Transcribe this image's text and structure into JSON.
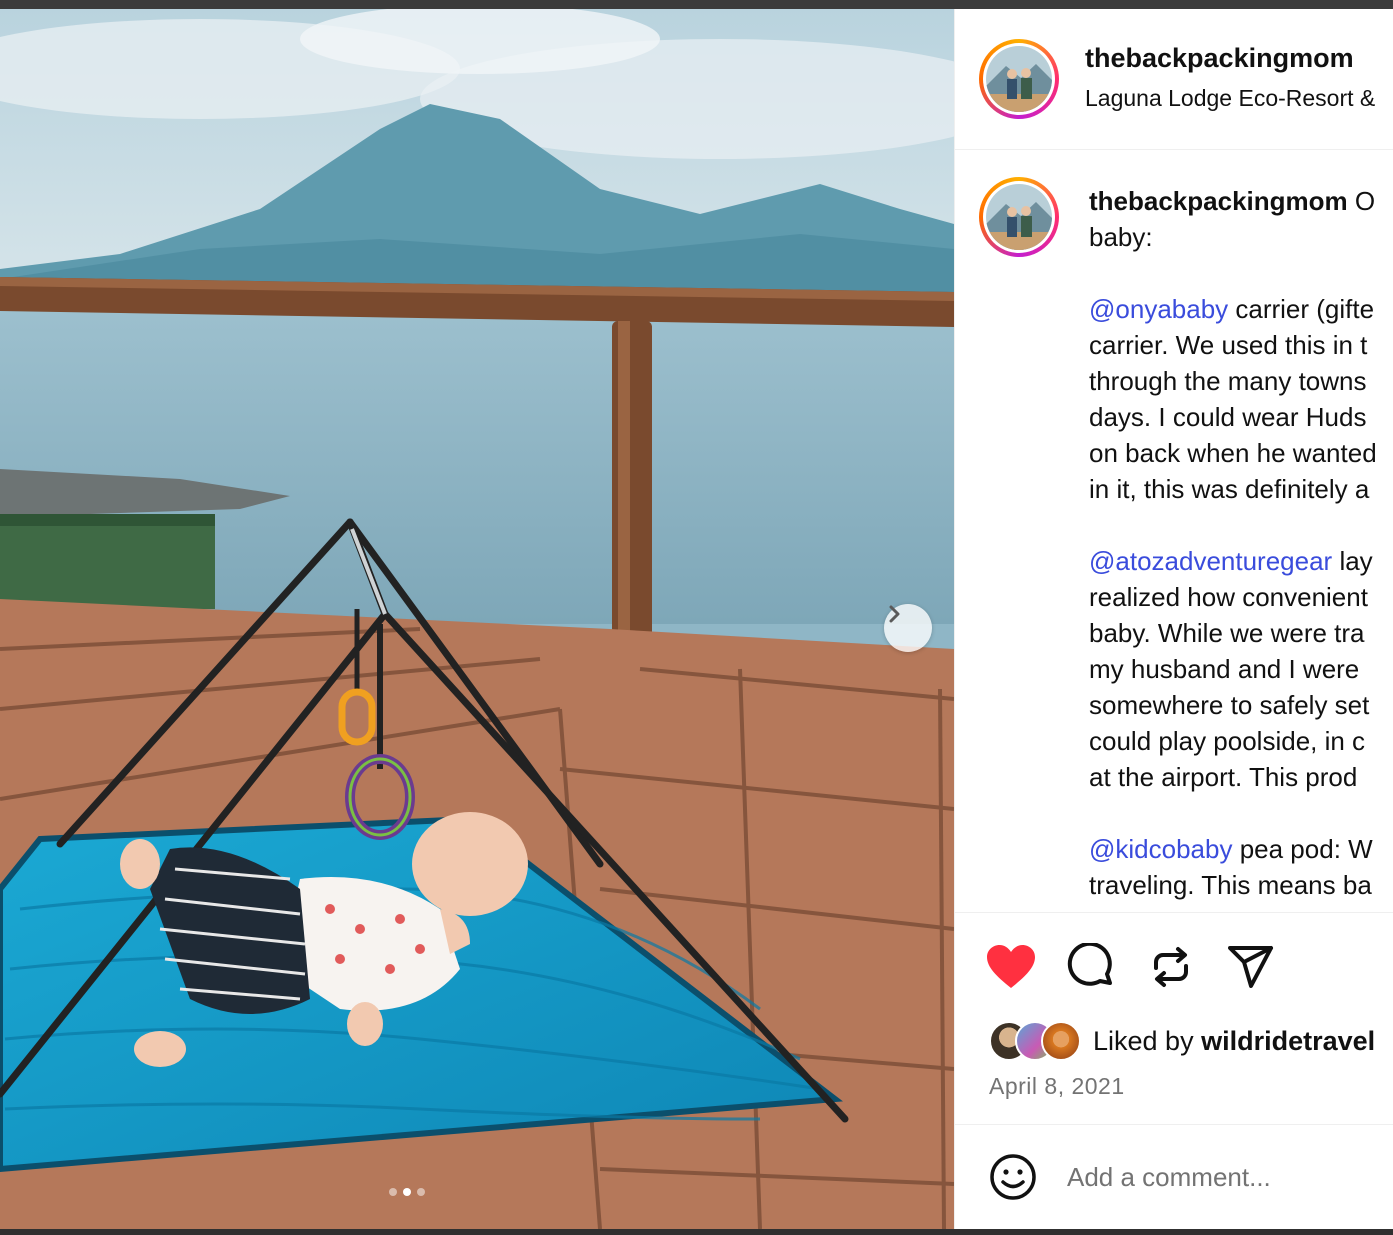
{
  "post": {
    "username": "thebackpackingmom",
    "location": "Laguna Lodge Eco-Resort &",
    "media": {
      "slide_count": 3,
      "active_slide": 2,
      "next_icon": "chevron-right-icon"
    }
  },
  "caption": {
    "username": "thebackpackingmom",
    "intro": [
      " O",
      "baby:"
    ],
    "p1": {
      "mention": "@onyababy",
      "first": " carrier (gifte",
      "lines": [
        "carrier. We used this in t",
        "through the many towns",
        "days. I could wear Huds",
        "on back when he wanted",
        "in it, this was definitely a"
      ]
    },
    "p2": {
      "mention": "@atozadventuregear",
      "first": " lay",
      "lines": [
        "realized how convenient",
        "baby. While we were tra",
        "my husband and I were",
        "somewhere to safely set",
        "could play poolside, in c",
        "at the airport. This prod"
      ]
    },
    "p3": {
      "mention": "@kidcobaby",
      "first": " pea pod: W",
      "lines": [
        "traveling. This means ba"
      ]
    }
  },
  "actions": {
    "icons": [
      "heart-icon",
      "comment-icon",
      "repost-icon",
      "share-icon"
    ],
    "like_color": "#ff3040",
    "liked_by_prefix": "Liked by ",
    "liked_by_user": "wildridetravel"
  },
  "date": "April 8, 2021",
  "comment": {
    "placeholder": "Add a comment...",
    "emoji_icon": "smiley-icon"
  }
}
